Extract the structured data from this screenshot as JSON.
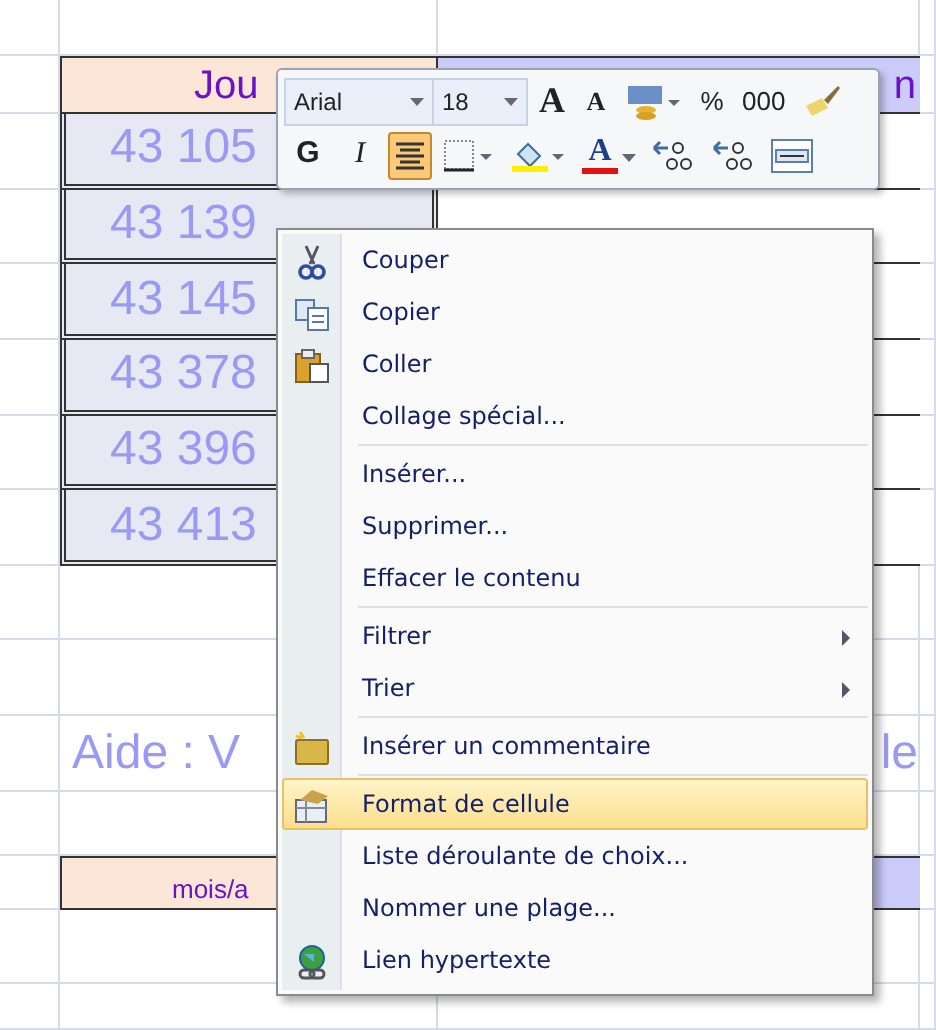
{
  "sheet": {
    "header": [
      {
        "text": "Jou"
      },
      {
        "text": "n"
      }
    ],
    "rows": [
      {
        "cells": [
          "43 105",
          ""
        ]
      },
      {
        "cells": [
          "43 139",
          ""
        ]
      },
      {
        "cells": [
          "43 145",
          ""
        ]
      },
      {
        "cells": [
          "43 378",
          ""
        ]
      },
      {
        "cells": [
          "43 396",
          ""
        ]
      },
      {
        "cells": [
          "43 413",
          ""
        ]
      }
    ],
    "help": {
      "left": "Aide : V",
      "right": "le"
    },
    "footer": {
      "left": "mois/a"
    }
  },
  "mini_toolbar": {
    "font": "Arial",
    "size": "18",
    "row1": [
      {
        "kind": "grow",
        "label": "A"
      },
      {
        "kind": "shrink",
        "label": "A"
      },
      {
        "kind": "accounting"
      },
      {
        "kind": "text",
        "label": "%"
      },
      {
        "kind": "text",
        "label": "000"
      },
      {
        "kind": "painter"
      }
    ],
    "row2": [
      {
        "kind": "bold",
        "label": "G",
        "selected": false
      },
      {
        "kind": "italic",
        "label": "I",
        "selected": false
      },
      {
        "kind": "center",
        "selected": true
      },
      {
        "kind": "borders"
      },
      {
        "kind": "fill"
      },
      {
        "kind": "fontcolor",
        "label": "A"
      },
      {
        "kind": "incdec"
      },
      {
        "kind": "decdec"
      },
      {
        "kind": "merge"
      }
    ]
  },
  "context_menu": [
    {
      "kind": "cut",
      "label": "Couper"
    },
    {
      "kind": "copy",
      "label": "Copier"
    },
    {
      "kind": "paste",
      "label": "Coller"
    },
    {
      "kind": "plain",
      "label": "Collage spécial..."
    },
    {
      "kind": "separator"
    },
    {
      "kind": "plain",
      "label": "Insérer..."
    },
    {
      "kind": "plain",
      "label": "Supprimer..."
    },
    {
      "kind": "plain",
      "label": "Effacer le contenu"
    },
    {
      "kind": "separator"
    },
    {
      "kind": "submenu",
      "label": "Filtrer"
    },
    {
      "kind": "submenu",
      "label": "Trier"
    },
    {
      "kind": "separator"
    },
    {
      "kind": "comment",
      "label": "Insérer un commentaire"
    },
    {
      "kind": "separator"
    },
    {
      "kind": "format",
      "label": "Format de cellule",
      "highlighted": true
    },
    {
      "kind": "plain",
      "label": "Liste déroulante de choix..."
    },
    {
      "kind": "plain",
      "label": "Nommer une plage..."
    },
    {
      "kind": "link",
      "label": "Lien hypertexte"
    }
  ]
}
